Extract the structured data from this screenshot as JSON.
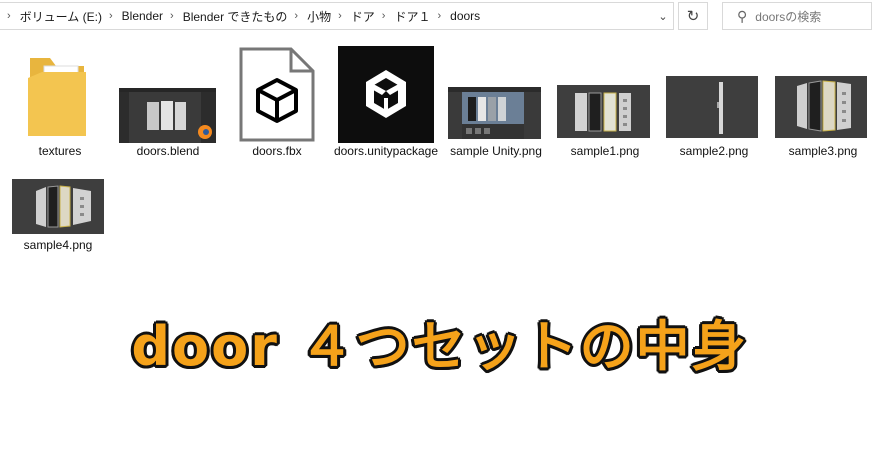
{
  "breadcrumb": {
    "items": [
      "ボリューム (E:)",
      "Blender",
      "Blender できたもの",
      "小物",
      "ドア",
      "ドア１",
      "doors"
    ]
  },
  "search": {
    "placeholder": "doorsの検索"
  },
  "files": [
    {
      "name": "textures",
      "kind": "folder"
    },
    {
      "name": "doors.blend",
      "kind": "blend"
    },
    {
      "name": "doors.fbx",
      "kind": "fbx"
    },
    {
      "name": "doors.unitypackage",
      "kind": "unitypackage"
    },
    {
      "name": "sample Unity.png",
      "kind": "png"
    },
    {
      "name": "sample1.png",
      "kind": "png"
    },
    {
      "name": "sample2.png",
      "kind": "png"
    },
    {
      "name": "sample3.png",
      "kind": "png"
    },
    {
      "name": "sample4.png",
      "kind": "png"
    }
  ],
  "banner": {
    "text": "door ４つセットの中身"
  },
  "colors": {
    "banner_fill": "#f5a21a",
    "banner_outline": "#111111",
    "folder": "#f3c550"
  },
  "icons": {
    "separator": "chevron-right-icon",
    "dropdown": "chevron-down-icon",
    "refresh": "refresh-icon",
    "search": "search-icon"
  }
}
